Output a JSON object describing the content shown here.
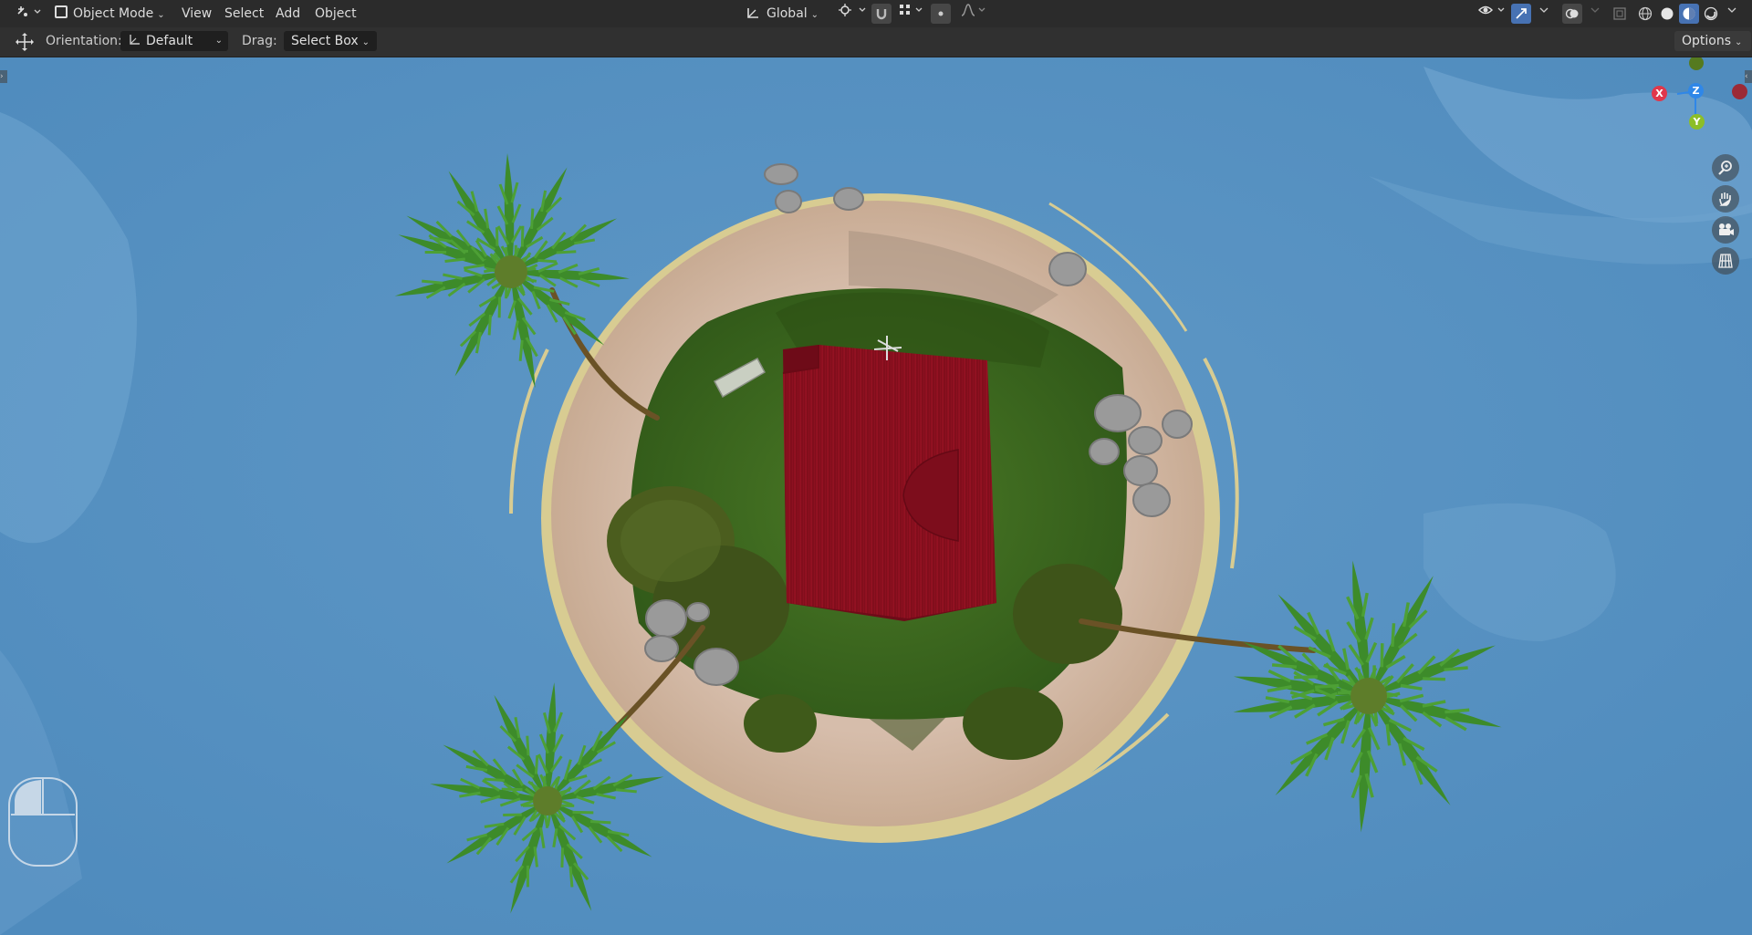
{
  "header": {
    "mode_label": "Object Mode",
    "menu": [
      "View",
      "Select",
      "Add",
      "Object"
    ],
    "transform_orientation": "Global"
  },
  "tool_header": {
    "orientation_label": "Orientation:",
    "orientation_value": "Default",
    "drag_label": "Drag:",
    "drag_value": "Select Box",
    "options_label": "Options"
  },
  "gizmo": {
    "axes": [
      "X",
      "Z",
      "Y"
    ],
    "colors": {
      "x": "#e0374b",
      "y": "#8cbe28",
      "z": "#2f87e8",
      "neg_x": "#9c2a36",
      "neg_y": "#557a1f"
    }
  },
  "navigation_icons": [
    "zoom-icon",
    "pan-hand-icon",
    "camera-icon",
    "grid-ortho-icon"
  ],
  "colors": {
    "water": "#5c95c3",
    "sand": "#d2b8a6",
    "grass": "#3e6a1f",
    "roof": "#8a1020",
    "palm": "#3d8028",
    "header_bg": "#2b2b2b",
    "accent": "#4772b3"
  }
}
